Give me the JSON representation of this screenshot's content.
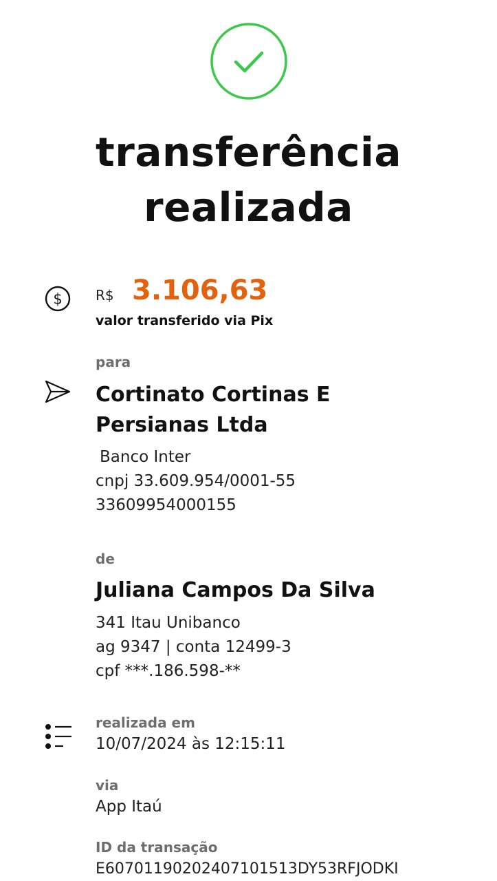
{
  "colors": {
    "success": "#3cc84a",
    "amount": "#e2620e",
    "text": "#111111",
    "muted": "#6e6e6e"
  },
  "header": {
    "icon": "check-circle-icon",
    "title_line1": "transferência",
    "title_line2": "realizada"
  },
  "amount": {
    "icon": "dollar-circle-icon",
    "currency": "R$",
    "value": "3.106,63",
    "caption": "valor transferido via Pix"
  },
  "recipient": {
    "icon": "send-icon",
    "label": "para",
    "name_line1": "Cortinato Cortinas E",
    "name_line2": "Persianas Ltda",
    "bank": "Banco Inter",
    "cnpj": "cnpj 33.609.954/0001-55",
    "key": "33609954000155"
  },
  "sender": {
    "label": "de",
    "name": "Juliana Campos Da Silva",
    "bank": "341 Itau Unibanco",
    "account": "ag 9347 | conta 12499-3",
    "cpf": "cpf ***.186.598-**"
  },
  "details": {
    "icon": "list-icon",
    "date_label": "realizada em",
    "date_value": "10/07/2024 às 12:15:11",
    "via_label": "via",
    "via_value": "App Itaú",
    "id_label": "ID da transação",
    "id_value": "E60701190202407101513DY53RFJODKI"
  }
}
